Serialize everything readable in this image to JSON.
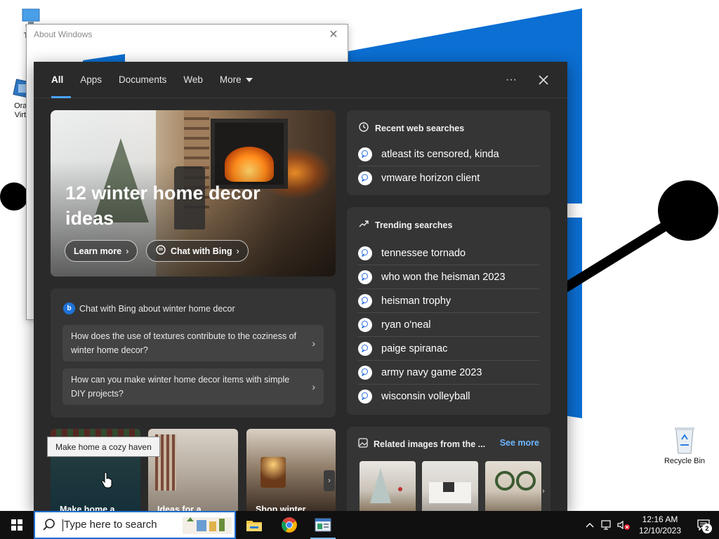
{
  "desktop": {
    "icons": [
      {
        "label": "This",
        "icon": "this-pc-icon"
      },
      {
        "label": "Orac\nVirtu",
        "icon": "virtualbox-icon"
      },
      {
        "label": "Recycle Bin",
        "icon": "recycle-bin-icon"
      }
    ]
  },
  "about_window": {
    "title": "About Windows",
    "close_icon": "close-icon"
  },
  "search_panel": {
    "tabs": [
      {
        "label": "All",
        "active": true
      },
      {
        "label": "Apps"
      },
      {
        "label": "Documents"
      },
      {
        "label": "Web"
      },
      {
        "label": "More"
      }
    ],
    "more_icon": "ellipsis-icon",
    "close_icon": "close-icon",
    "hero": {
      "title": "12 winter home decor ideas",
      "learn_more": "Learn more",
      "chat_with_bing": "Chat with Bing"
    },
    "chat_card": {
      "header": "Chat with Bing about winter home decor",
      "questions": [
        "How does the use of textures contribute to the coziness of winter home decor?",
        "How can you make winter home decor items with simple DIY projects?"
      ]
    },
    "thumbnails": [
      {
        "label": "Make home a"
      },
      {
        "label": "Ideas for a"
      },
      {
        "label": "Shop winter"
      }
    ],
    "recent": {
      "header": "Recent web searches",
      "items": [
        "atleast its censored, kinda",
        "vmware horizon client"
      ]
    },
    "trending": {
      "header": "Trending searches",
      "items": [
        "tennessee tornado",
        "who won the heisman 2023",
        "heisman trophy",
        "ryan o'neal",
        "paige spiranac",
        "army navy game 2023",
        "wisconsin volleyball"
      ]
    },
    "related": {
      "header": "Related images from the ...",
      "see_more": "See more"
    },
    "tooltip": "Make home a cozy haven"
  },
  "taskbar": {
    "search_placeholder": "Type here to search",
    "apps": [
      "file-explorer-icon",
      "chrome-icon",
      "system-info-icon"
    ],
    "clock_time": "12:16 AM",
    "clock_date": "12/10/2023",
    "notification_count": "2"
  },
  "colors": {
    "accent": "#4aa3ff",
    "panel_bg": "#2a2a2a",
    "card_bg": "#353535",
    "wallpaper_blue": "#0b6fd3",
    "taskbar_bg": "#101010"
  }
}
